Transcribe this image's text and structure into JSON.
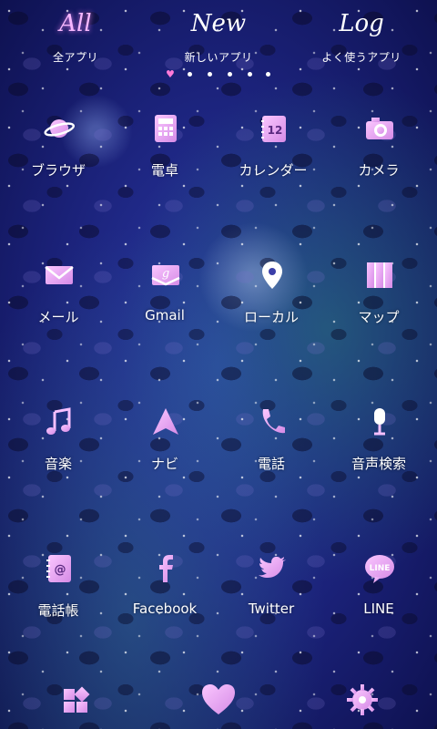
{
  "tabs": [
    {
      "script": "All",
      "label": "全アプリ",
      "active": true
    },
    {
      "script": "New",
      "label": "新しいアプリ",
      "active": false
    },
    {
      "script": "Log",
      "label": "よく使うアプリ",
      "active": false
    }
  ],
  "page_indicator": {
    "count": 6,
    "current": 1
  },
  "apps": [
    {
      "label": "ブラウザ",
      "icon": "planet-icon"
    },
    {
      "label": "電卓",
      "icon": "calculator-icon"
    },
    {
      "label": "カレンダー",
      "icon": "calendar-icon"
    },
    {
      "label": "カメラ",
      "icon": "camera-icon"
    },
    {
      "label": "メール",
      "icon": "mail-icon"
    },
    {
      "label": "Gmail",
      "icon": "gmail-icon"
    },
    {
      "label": "ローカル",
      "icon": "location-pin-icon"
    },
    {
      "label": "マップ",
      "icon": "map-icon"
    },
    {
      "label": "音楽",
      "icon": "music-note-icon"
    },
    {
      "label": "ナビ",
      "icon": "navigation-arrow-icon"
    },
    {
      "label": "電話",
      "icon": "phone-icon"
    },
    {
      "label": "音声検索",
      "icon": "microphone-icon"
    },
    {
      "label": "電話帳",
      "icon": "contacts-book-icon"
    },
    {
      "label": "Facebook",
      "icon": "facebook-icon"
    },
    {
      "label": "Twitter",
      "icon": "twitter-bird-icon"
    },
    {
      "label": "LINE",
      "icon": "line-icon"
    }
  ],
  "calendar_icon_number": "12",
  "line_icon_text": "LINE",
  "dock": [
    {
      "icon": "widgets-icon"
    },
    {
      "icon": "heart-icon"
    },
    {
      "icon": "settings-gear-icon"
    }
  ],
  "colors": {
    "icon_pink": "#f3a6f5",
    "icon_pink_dark": "#c66fd8",
    "accent_heart": "#ff7ad9"
  }
}
